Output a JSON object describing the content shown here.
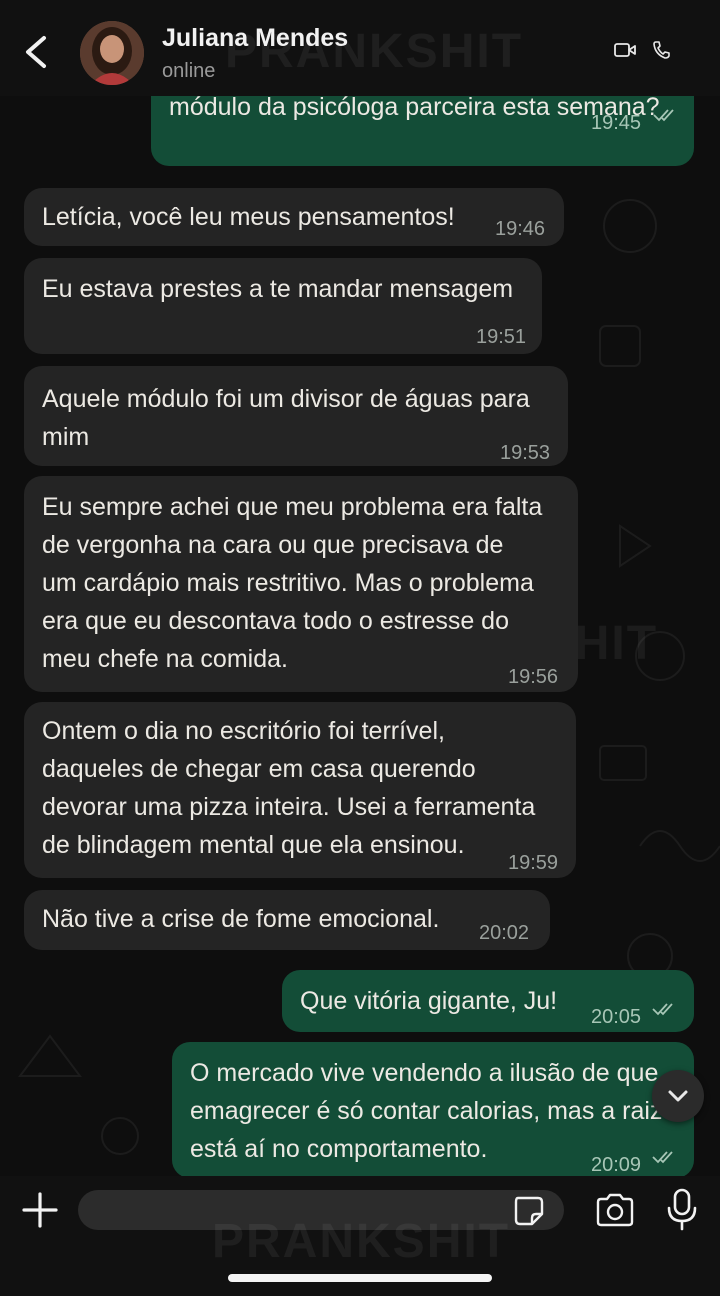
{
  "header": {
    "contact_name": "Juliana Mendes",
    "status": "online",
    "icons": [
      "back-arrow-icon",
      "video-call-icon",
      "voice-call-icon"
    ]
  },
  "watermark": "PRANKSHIT",
  "messages": [
    {
      "direction": "out",
      "lines": [
        "módulo da psicóloga parceira esta semana?"
      ],
      "time": "19:45",
      "read": true
    },
    {
      "direction": "in",
      "lines": [
        "Letícia, você leu meus pensamentos!"
      ],
      "time": "19:46"
    },
    {
      "direction": "in",
      "lines": [
        "Eu estava prestes a te mandar mensagem"
      ],
      "time": "19:51"
    },
    {
      "direction": "in",
      "lines": [
        "Aquele módulo foi um divisor de águas para",
        "mim"
      ],
      "time": "19:53"
    },
    {
      "direction": "in",
      "lines": [
        "Eu sempre achei que meu problema era falta",
        "de vergonha na cara ou que precisava de",
        "um cardápio mais restritivo. Mas o problema",
        "era que eu descontava todo o estresse do",
        "meu chefe na comida."
      ],
      "time": "19:56"
    },
    {
      "direction": "in",
      "lines": [
        "Ontem o dia no escritório foi terrível,",
        "daqueles de chegar em casa querendo",
        "devorar uma pizza inteira. Usei a ferramenta",
        "de blindagem mental que ela ensinou."
      ],
      "time": "19:59"
    },
    {
      "direction": "in",
      "lines": [
        "Não tive a crise de fome emocional."
      ],
      "time": "20:02"
    },
    {
      "direction": "out",
      "lines": [
        "Que vitória gigante, Ju!"
      ],
      "time": "20:05",
      "read": true
    },
    {
      "direction": "out",
      "lines": [
        "O mercado vive vendendo a ilusão de que",
        "emagrecer é só contar calorias, mas a raiz",
        "está aí no comportamento."
      ],
      "time": "20:09",
      "read": true
    }
  ],
  "composer": {
    "icons": [
      "plus-icon",
      "sticker-icon",
      "camera-icon",
      "microphone-icon"
    ]
  },
  "colors": {
    "incoming_bubble": "#242424",
    "outgoing_bubble": "#134d37",
    "background": "#0e0e0e"
  }
}
